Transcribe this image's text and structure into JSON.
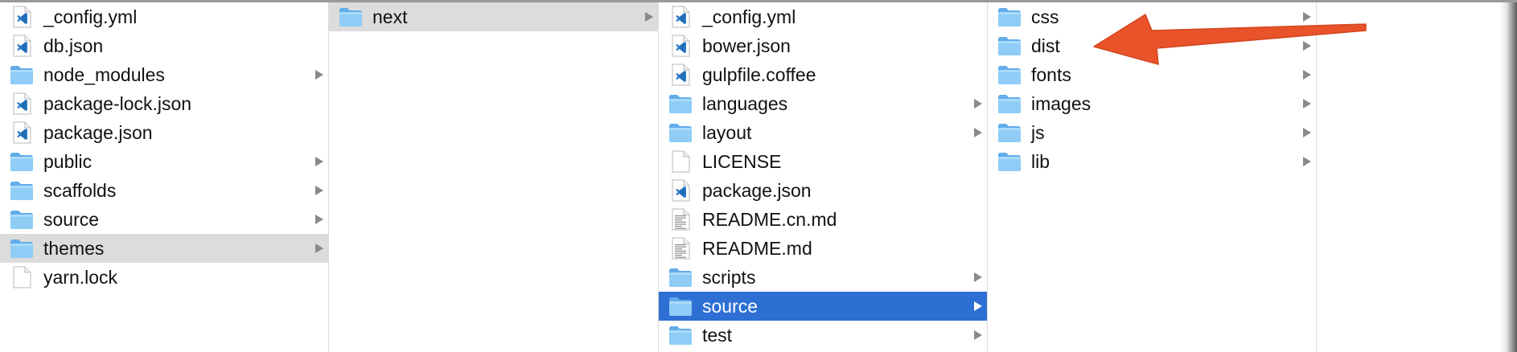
{
  "columns": [
    {
      "items": [
        {
          "label": "_config.yml",
          "icon": "vscode-file-icon",
          "chevron": false,
          "state": "normal"
        },
        {
          "label": "db.json",
          "icon": "vscode-file-icon",
          "chevron": false,
          "state": "normal"
        },
        {
          "label": "node_modules",
          "icon": "folder-icon",
          "chevron": true,
          "state": "normal"
        },
        {
          "label": "package-lock.json",
          "icon": "vscode-file-icon",
          "chevron": false,
          "state": "normal"
        },
        {
          "label": "package.json",
          "icon": "vscode-file-icon",
          "chevron": false,
          "state": "normal"
        },
        {
          "label": "public",
          "icon": "folder-icon",
          "chevron": true,
          "state": "normal"
        },
        {
          "label": "scaffolds",
          "icon": "folder-icon",
          "chevron": true,
          "state": "normal"
        },
        {
          "label": "source",
          "icon": "folder-icon",
          "chevron": true,
          "state": "normal"
        },
        {
          "label": "themes",
          "icon": "folder-icon",
          "chevron": true,
          "state": "highlighted"
        },
        {
          "label": "yarn.lock",
          "icon": "blank-file-icon",
          "chevron": false,
          "state": "normal"
        }
      ]
    },
    {
      "items": [
        {
          "label": "next",
          "icon": "folder-icon",
          "chevron": true,
          "state": "highlighted"
        }
      ]
    },
    {
      "items": [
        {
          "label": "_config.yml",
          "icon": "vscode-file-icon",
          "chevron": false,
          "state": "normal"
        },
        {
          "label": "bower.json",
          "icon": "vscode-file-icon",
          "chevron": false,
          "state": "normal"
        },
        {
          "label": "gulpfile.coffee",
          "icon": "vscode-file-icon",
          "chevron": false,
          "state": "normal"
        },
        {
          "label": "languages",
          "icon": "folder-icon",
          "chevron": true,
          "state": "normal"
        },
        {
          "label": "layout",
          "icon": "folder-icon",
          "chevron": true,
          "state": "normal"
        },
        {
          "label": "LICENSE",
          "icon": "blank-file-icon",
          "chevron": false,
          "state": "normal"
        },
        {
          "label": "package.json",
          "icon": "vscode-file-icon",
          "chevron": false,
          "state": "normal"
        },
        {
          "label": "README.cn.md",
          "icon": "text-file-icon",
          "chevron": false,
          "state": "normal"
        },
        {
          "label": "README.md",
          "icon": "text-file-icon",
          "chevron": false,
          "state": "normal"
        },
        {
          "label": "scripts",
          "icon": "folder-icon",
          "chevron": true,
          "state": "normal"
        },
        {
          "label": "source",
          "icon": "folder-icon",
          "chevron": true,
          "state": "selected"
        },
        {
          "label": "test",
          "icon": "folder-icon",
          "chevron": true,
          "state": "normal"
        }
      ]
    },
    {
      "items": [
        {
          "label": "css",
          "icon": "folder-icon",
          "chevron": true,
          "state": "normal"
        },
        {
          "label": "dist",
          "icon": "folder-icon",
          "chevron": true,
          "state": "normal"
        },
        {
          "label": "fonts",
          "icon": "folder-icon",
          "chevron": true,
          "state": "normal"
        },
        {
          "label": "images",
          "icon": "folder-icon",
          "chevron": true,
          "state": "normal"
        },
        {
          "label": "js",
          "icon": "folder-icon",
          "chevron": true,
          "state": "normal"
        },
        {
          "label": "lib",
          "icon": "folder-icon",
          "chevron": true,
          "state": "normal"
        }
      ]
    },
    {
      "items": []
    }
  ],
  "annotation": {
    "icon": "red-arrow-icon",
    "color": "#e8532a",
    "points_to": "dist"
  },
  "colors": {
    "selection": "#2d6fd3",
    "highlight": "#dcdcdc",
    "folder": "#7cc1f2",
    "vscode": "#2b7bc9"
  }
}
